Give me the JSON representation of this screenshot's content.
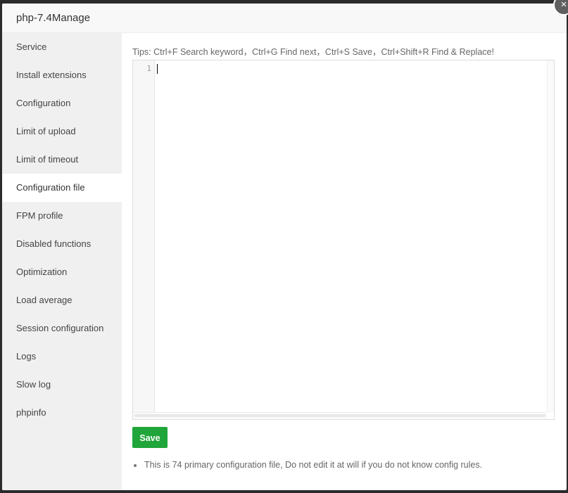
{
  "dialog": {
    "title": "php-7.4Manage",
    "close_glyph": "×"
  },
  "sidebar": {
    "active_index": 5,
    "items": [
      {
        "label": "Service"
      },
      {
        "label": "Install extensions"
      },
      {
        "label": "Configuration"
      },
      {
        "label": "Limit of upload"
      },
      {
        "label": "Limit of timeout"
      },
      {
        "label": "Configuration file"
      },
      {
        "label": "FPM profile"
      },
      {
        "label": "Disabled functions"
      },
      {
        "label": "Optimization"
      },
      {
        "label": "Load average"
      },
      {
        "label": "Session configuration"
      },
      {
        "label": "Logs"
      },
      {
        "label": "Slow log"
      },
      {
        "label": "phpinfo"
      }
    ]
  },
  "main": {
    "tips": "Tips: Ctrl+F Search keyword，Ctrl+G Find next，Ctrl+S Save，Ctrl+Shift+R Find & Replace!",
    "editor": {
      "line_number": "1",
      "content": ""
    },
    "save_label": "Save",
    "notes": [
      "This is 74 primary configuration file, Do not edit it at will if you do not know config rules."
    ]
  },
  "colors": {
    "accent": "#20a53a",
    "sidebar_bg": "#f0f0f0",
    "active_bg": "#ffffff"
  }
}
